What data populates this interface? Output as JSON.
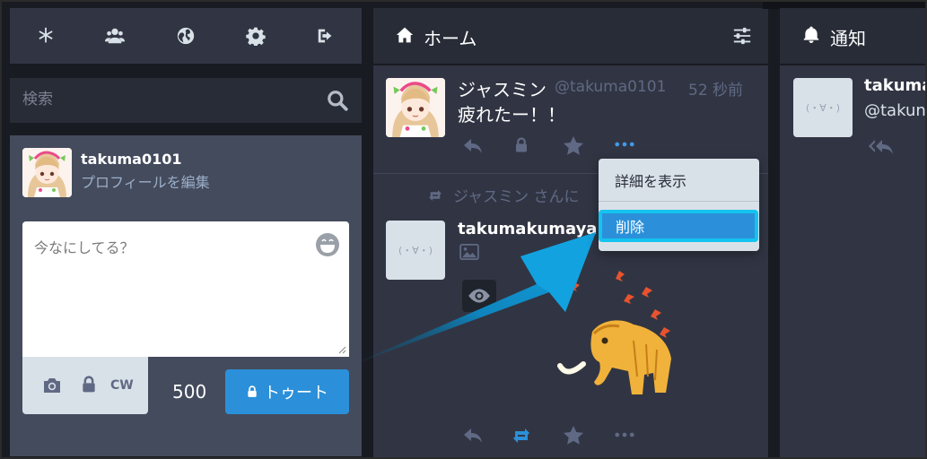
{
  "nav": {
    "icons": [
      "getting-started-icon",
      "local-timeline-icon",
      "federated-timeline-icon",
      "preferences-icon",
      "logout-icon"
    ]
  },
  "search": {
    "placeholder": "検索"
  },
  "compose": {
    "username": "takuma0101",
    "edit_profile": "プロフィールを編集",
    "placeholder": "今なにしてる？",
    "cw_label": "CW",
    "char_count": "500",
    "toot_label": "トゥート"
  },
  "home": {
    "title": "ホーム",
    "status1": {
      "display_name": "ジャスミン",
      "acct": "@takuma0101",
      "time": "52 秒前",
      "content": "疲れたー！！"
    },
    "reblog_notice": "ジャスミン さんに",
    "status2": {
      "display_name": "takumakumayak",
      "avatar_text": "(・∀・)"
    }
  },
  "dropdown": {
    "items": [
      "詳細を表示",
      "削除"
    ]
  },
  "notifications": {
    "title": "通知",
    "name": "takuma",
    "acct": "@takun",
    "avatar_text": "(・∀・)"
  },
  "colors": {
    "accent": "#2b90d9",
    "highlight": "#14c3f0",
    "background": "#191b22"
  }
}
